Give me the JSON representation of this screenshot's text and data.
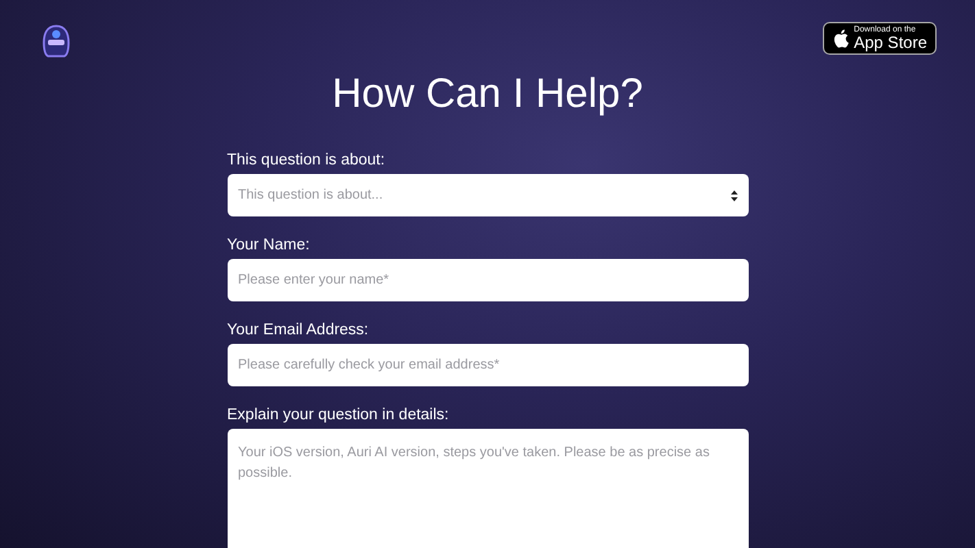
{
  "header": {
    "store_badge": {
      "small_text": "Download on the",
      "large_text": "App Store"
    }
  },
  "title": "How Can I Help?",
  "form": {
    "fields": [
      {
        "kind": "select",
        "label": "This question is about:",
        "placeholder": "This question is about..."
      },
      {
        "kind": "input",
        "label": "Your Name:",
        "placeholder": "Please enter your name*"
      },
      {
        "kind": "input",
        "label": "Your Email Address:",
        "placeholder": "Please carefully check your email address*"
      },
      {
        "kind": "textarea",
        "label": "Explain your question in details:",
        "placeholder": "Your iOS version, Auri AI version, steps you've taken. Please be as precise as possible."
      }
    ]
  }
}
